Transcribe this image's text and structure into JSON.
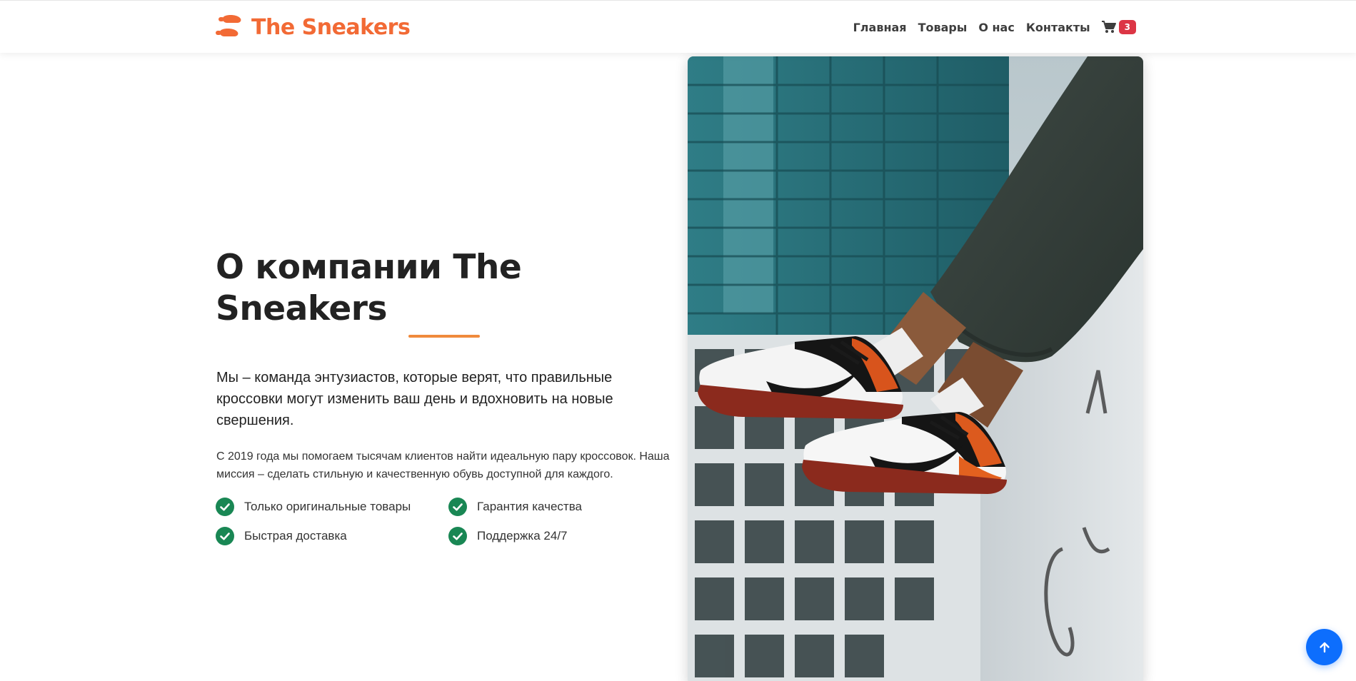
{
  "brand": {
    "name": "The Sneakers",
    "logo_icon": "shoe-prints-icon",
    "color": "#f26a35"
  },
  "nav": {
    "links": [
      "Главная",
      "Товары",
      "О нас",
      "Контакты"
    ],
    "cart": {
      "icon": "cart-icon",
      "count": "3",
      "badge_color": "#dc3545"
    }
  },
  "about": {
    "title": "О компании The Sneakers",
    "lead": "Мы – команда энтузиастов, которые верят, что правильные кроссовки могут изменить ваш день и вдохновить на новые свершения.",
    "description": "С 2019 года мы помогаем тысячам клиентов найти идеальную пару кроссовок. Наша миссия – сделать стильную и качественную обувь доступной для каждого.",
    "features": [
      "Только оригинальные товары",
      "Гарантия качества",
      "Быстрая доставка",
      "Поддержка 24/7"
    ],
    "feature_icon": "check-circle-icon",
    "accent": "#f08a3c",
    "check_color": "#198754"
  },
  "hero_image": {
    "subject": "sneakers-photo"
  },
  "scroll_top": {
    "icon": "arrow-up-icon",
    "color": "#0d6efd"
  }
}
